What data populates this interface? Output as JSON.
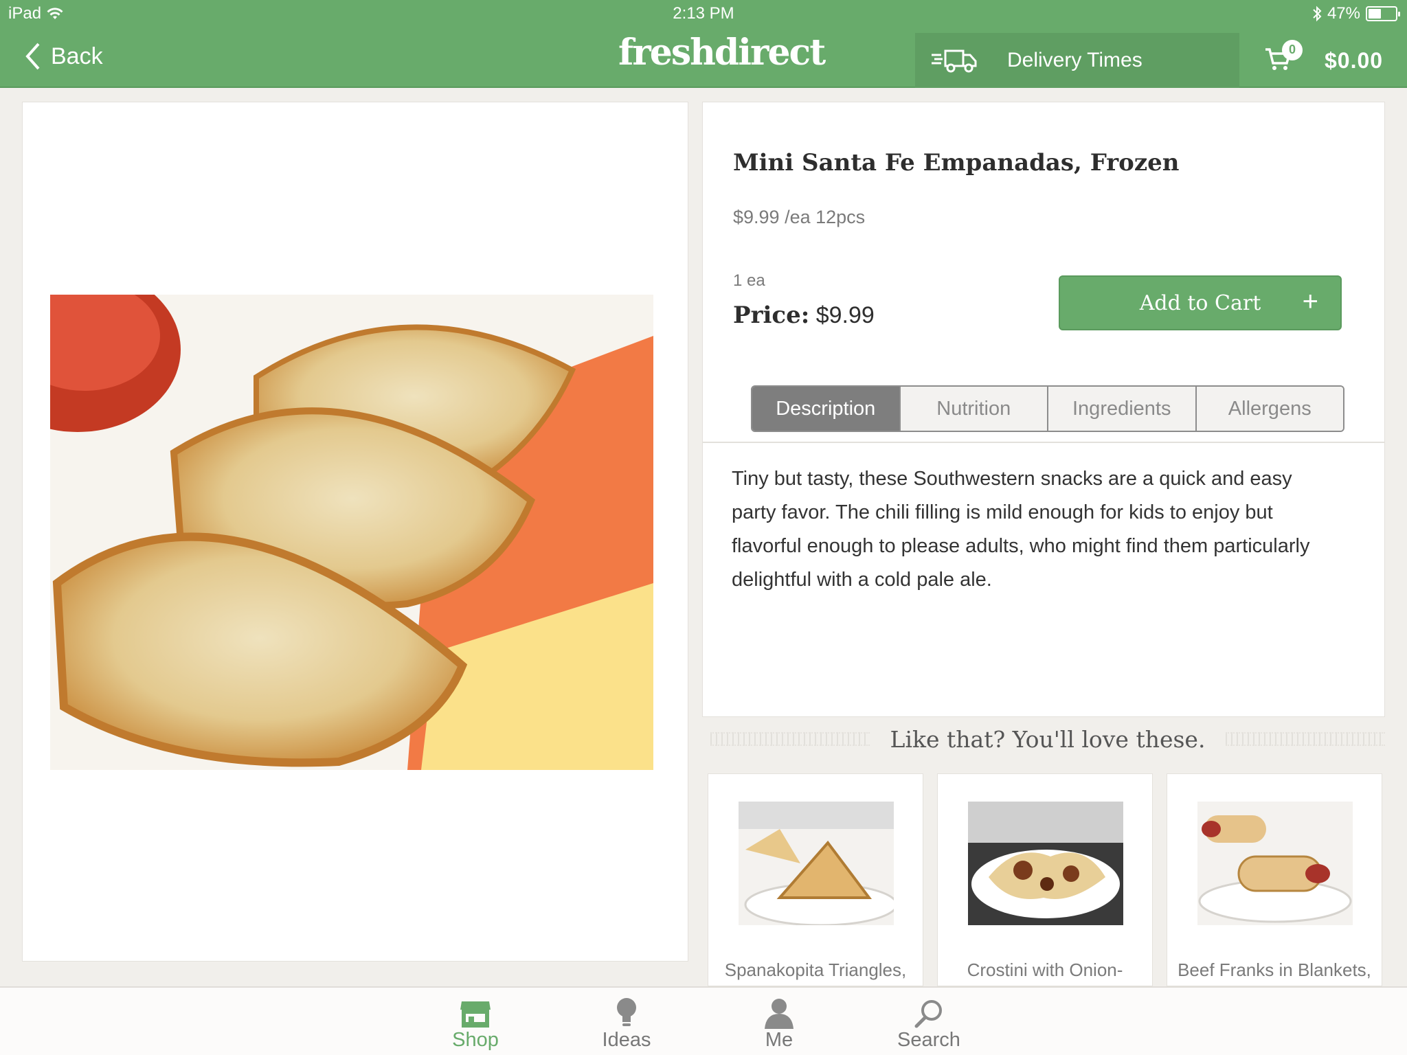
{
  "status_bar": {
    "device": "iPad",
    "time": "2:13 PM",
    "battery": "47%",
    "battery_level": 0.47
  },
  "nav": {
    "back_label": "Back",
    "logo_text": "freshdirect",
    "delivery_label": "Delivery Times",
    "cart_count": "0",
    "cart_total": "$0.00"
  },
  "product": {
    "title": "Mini Santa Fe Empanadas, Frozen",
    "unit_price": "$9.99 /ea 12pcs",
    "qty_label": "1 ea",
    "price_label": "Price:",
    "price_value": "$9.99",
    "add_to_cart_label": "Add to Cart",
    "add_icon": "+"
  },
  "tabs": [
    {
      "label": "Description",
      "active": true
    },
    {
      "label": "Nutrition",
      "active": false
    },
    {
      "label": "Ingredients",
      "active": false
    },
    {
      "label": "Allergens",
      "active": false
    }
  ],
  "description": "Tiny but tasty, these Southwestern snacks are a quick and easy party favor. The chili filling is mild enough for kids to enjoy but flavorful enough to please adults, who might find them particularly delightful with a cold pale ale.",
  "recommendations": {
    "title": "Like that? You'll love these.",
    "items": [
      {
        "name": "Spanakopita Triangles,"
      },
      {
        "name": "Crostini with Onion-"
      },
      {
        "name": "Beef Franks in Blankets,"
      }
    ]
  },
  "tabbar": [
    {
      "label": "Shop",
      "icon": "shop-icon",
      "active": true
    },
    {
      "label": "Ideas",
      "icon": "lightbulb-icon",
      "active": false
    },
    {
      "label": "Me",
      "icon": "person-icon",
      "active": false
    },
    {
      "label": "Search",
      "icon": "search-icon",
      "active": false
    }
  ],
  "colors": {
    "brand_green": "#68ab6b",
    "active_tab": "#7e7e7e"
  }
}
